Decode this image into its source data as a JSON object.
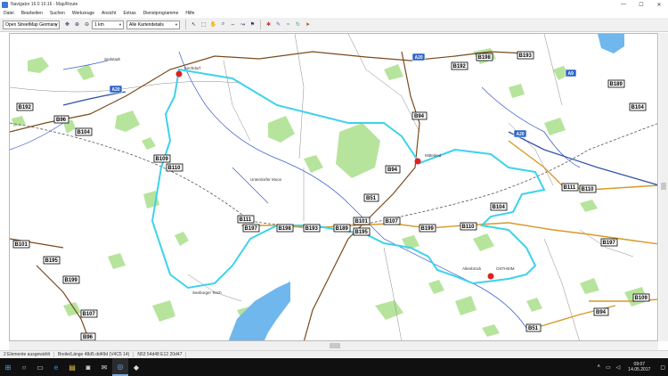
{
  "window": {
    "title": "Navigator 16.0 10.16 - Map/Route",
    "minimize": "—",
    "maximize": "☐",
    "close": "✕"
  },
  "menu": [
    "Datei",
    "Bearbeiten",
    "Suchen",
    "Werkzeuge",
    "Ansicht",
    "Extras",
    "Dienstprogramme",
    "Hilfe"
  ],
  "toolbar": {
    "map_select": "Open StreetMap Germany",
    "scale_select": "1 km",
    "layer_select": "Alle Kartendetails"
  },
  "map": {
    "places": {
      "northwest_town": "Südstadt",
      "center_area": "Unterdorfer Moos",
      "lake": "Seeburger Teich",
      "east_town": "Altenbrück",
      "marker_north": "Kirchdorf",
      "marker_mid": "Mittelried",
      "marker_east": "OSTHEIM"
    },
    "roads": {
      "a20": "A20",
      "a9": "A9",
      "b192": "B192",
      "b96": "B96",
      "b104": "B104",
      "b109": "B109",
      "b110": "B110",
      "b111": "B111",
      "b197": "B197",
      "b198": "B198",
      "b193": "B193",
      "b189": "B189",
      "b101": "B101",
      "b94": "B94",
      "b107": "B107",
      "b51": "B51",
      "b195": "B195",
      "b199": "B199",
      "b110x": "B110"
    }
  },
  "status": {
    "elements": "2 Elemente ausgewählt",
    "coords": "Breite/Länge 48d5 dd49d (V4C5 14)",
    "position": "N53 54d48 E12 20d47"
  },
  "taskbar": {
    "clock_time": "09:07",
    "clock_date": "14.05.2017"
  }
}
